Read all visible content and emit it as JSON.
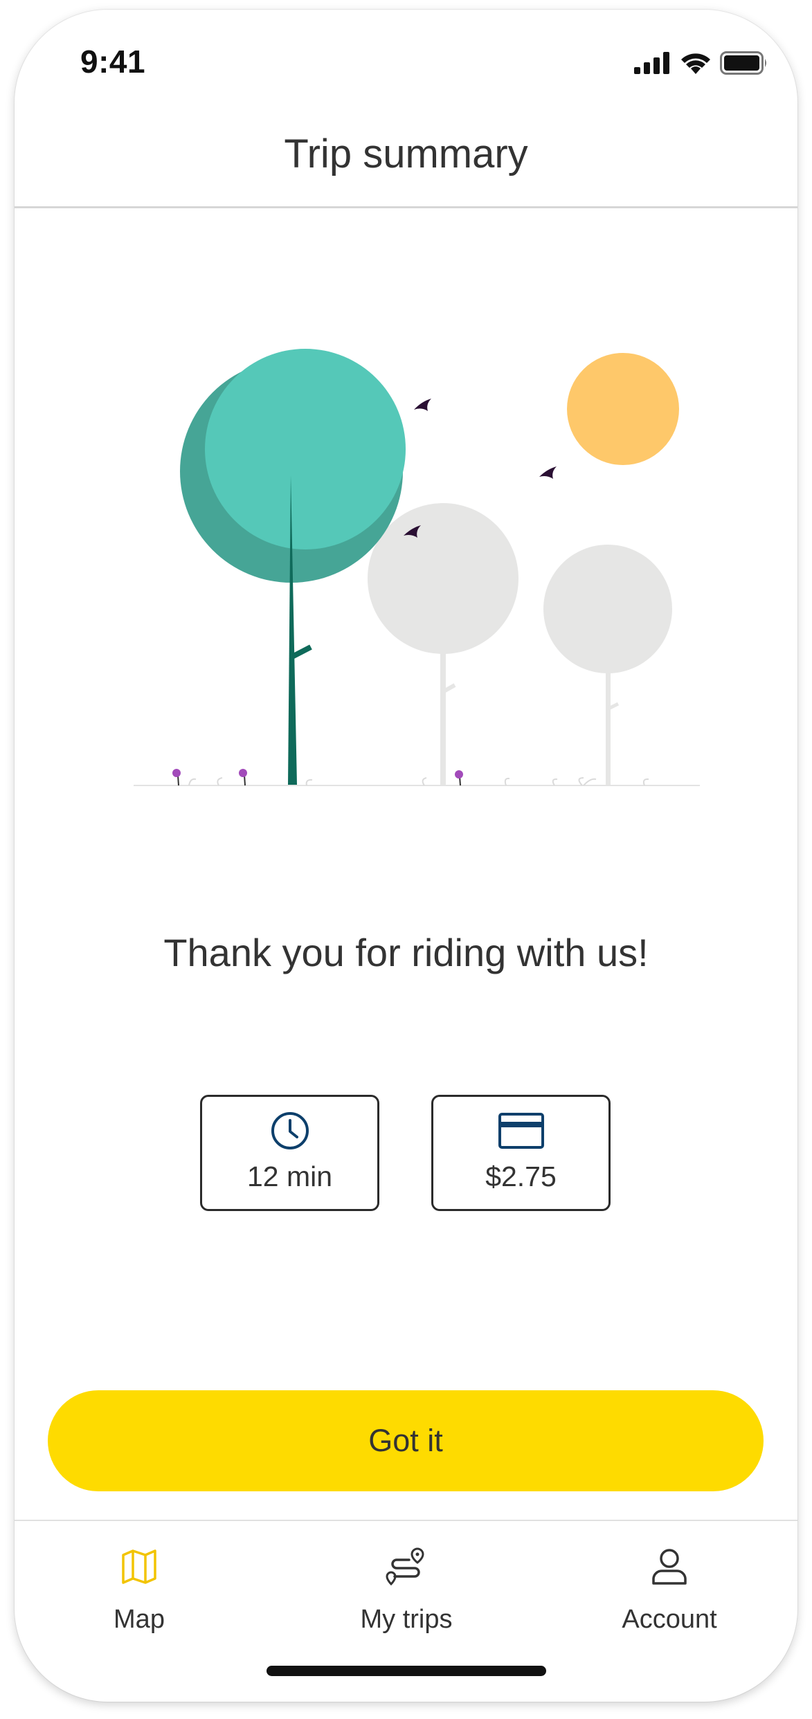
{
  "status_bar": {
    "time": "9:41",
    "icons": [
      "cellular-signal-icon",
      "wifi-icon",
      "battery-icon"
    ]
  },
  "header": {
    "title": "Trip summary"
  },
  "illustration": {
    "description_icon": "trees-birds-sun-illustration",
    "colors": {
      "tree_main": "#55C8B8",
      "tree_shade": "#46A596",
      "trunk": "#0F6A5A",
      "tree_grey": "#E6E6E5",
      "sun": "#FEC86A",
      "bird": "#2A0F33",
      "flower": "#A24BBA"
    }
  },
  "message": "Thank you for riding with us!",
  "trip_details": {
    "duration": {
      "icon": "clock-icon",
      "value": "12 min"
    },
    "cost": {
      "icon": "credit-card-icon",
      "value": "$2.75"
    }
  },
  "actions": {
    "primary_label": "Got it"
  },
  "tab_bar": {
    "tabs": [
      {
        "label": "Map",
        "icon": "map-icon",
        "active": true
      },
      {
        "label": "My trips",
        "icon": "route-icon",
        "active": false
      },
      {
        "label": "Account",
        "icon": "person-icon",
        "active": false
      }
    ]
  },
  "colors": {
    "accent": "#FEDB00",
    "active_tab_icon": "#F2C400",
    "card_icon": "#0D3F6B",
    "text": "#333333"
  }
}
